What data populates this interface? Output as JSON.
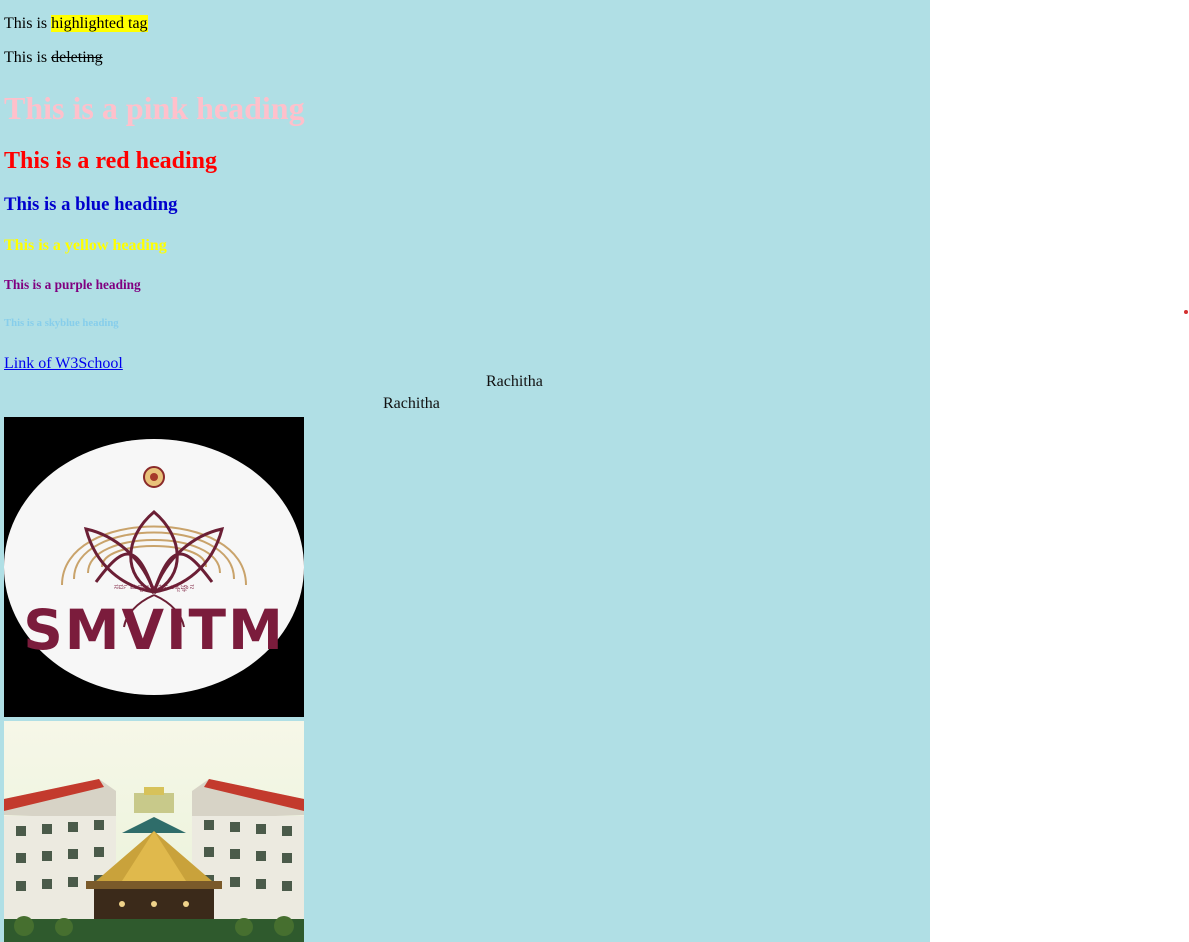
{
  "page": {
    "background": "#b0dfe5",
    "line1": {
      "prefix": "This is ",
      "highlight": "highlighted tag",
      "highlight_color": "#ffff00"
    },
    "line2": {
      "prefix": "This is ",
      "deleted": "deleting"
    },
    "headings": [
      {
        "text": "This is a pink heading",
        "color": "#ffc0cb"
      },
      {
        "text": "This is a red heading",
        "color": "#ff0000"
      },
      {
        "text": "This is a blue heading",
        "color": "#0000cd"
      },
      {
        "text": "This is a yellow heading",
        "color": "#ffff00"
      },
      {
        "text": "This is a purple heading",
        "color": "#800080"
      },
      {
        "text": "This is a skyblue heading",
        "color": "#87ceeb"
      }
    ],
    "link": {
      "text": "Link of W3School",
      "color": "#0000ee"
    },
    "center_text_1": "Rachitha",
    "center_text_2": "Rachitha",
    "logo": {
      "text": "SMVITM",
      "subtext": "ಸರ್ವ ಮಧ್ವಾಚಾರ್ಯ ತತ್ವಜ್ಞಾನ",
      "text_color": "#7b1c3c"
    },
    "indicator_color": "#d32f2f"
  }
}
